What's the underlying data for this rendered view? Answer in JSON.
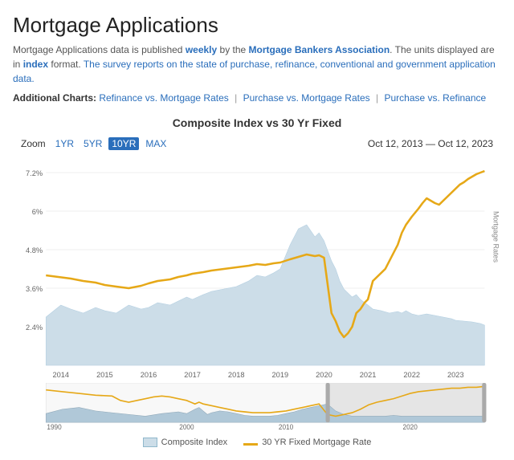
{
  "page": {
    "title": "Mortgage Applications",
    "description_part1": "Mortgage Applications data is published ",
    "description_weekly": "weekly",
    "description_part2": " by the ",
    "description_org": "Mortgage Bankers Association",
    "description_part3": ". The units displayed are in ",
    "description_index": "index",
    "description_part4": " format. ",
    "description_blue": "The survey reports on the state of purchase, refinance, conventional and government application data."
  },
  "additional_charts": {
    "label": "Additional Charts:",
    "links": [
      "Refinance vs. Mortgage Rates",
      "Purchase vs. Mortgage Rates",
      "Purchase vs. Refinance"
    ]
  },
  "chart": {
    "title": "Composite Index vs 30 Yr Fixed",
    "zoom_label": "Zoom",
    "zoom_options": [
      "1YR",
      "5YR",
      "10YR",
      "MAX"
    ],
    "zoom_active": "10YR",
    "date_range_start": "Oct 12, 2013",
    "date_range_separator": "—",
    "date_range_end": "Oct 12, 2023",
    "y_axis_label": "Mortgage Rates",
    "y_axis_values": [
      "7.2%",
      "6%",
      "4.8%",
      "3.6%",
      "2.4%"
    ],
    "x_axis_years": [
      "2014",
      "2015",
      "2016",
      "2017",
      "2018",
      "2019",
      "2020",
      "2021",
      "2022",
      "2023"
    ],
    "mini_x_labels": [
      "1990",
      "2000",
      "2010",
      "2020"
    ],
    "legend": {
      "composite_label": "Composite Index",
      "mortgage_label": "30 YR Fixed Mortgage Rate"
    }
  },
  "colors": {
    "composite_fill": "#ccdde8",
    "composite_stroke": "#b0cde0",
    "mortgage_line": "#e6a817",
    "grid_line": "#e0e0e0",
    "highlight_bg": "#e8e8e8"
  }
}
